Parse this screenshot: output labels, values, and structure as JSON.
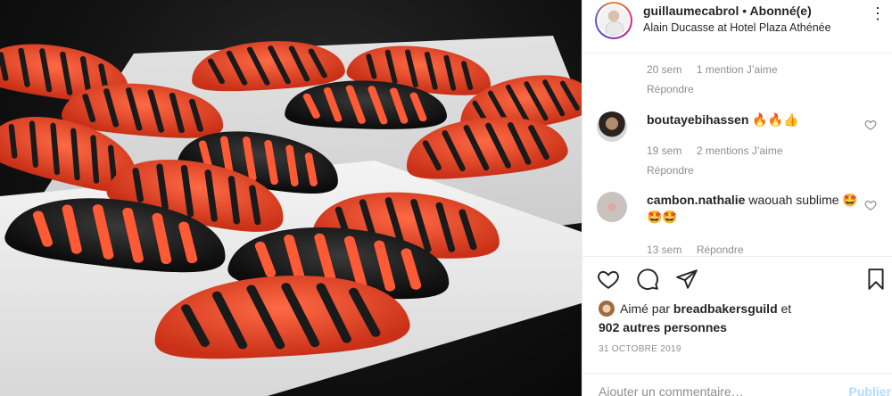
{
  "post": {
    "username": "guillaumecabrol",
    "separator": "•",
    "follow_state": "Abonné(e)",
    "location": "Alain Ducasse at Hotel Plaza Athénée",
    "more_icon": "⋮",
    "photo_alt": "Red and black striped pastries arranged on white plates"
  },
  "comments": [
    {
      "time": "20 sem",
      "likes": "1 mention J’aime",
      "reply": "Répondre"
    },
    {
      "user": "boutayebihassen",
      "text": "🔥🔥👍",
      "time": "19 sem",
      "likes": "2 mentions J’aime",
      "reply": "Répondre"
    },
    {
      "user": "cambon.nathalie",
      "text": "waouah sublime 🤩🤩🤩",
      "time": "13 sem",
      "reply": "Répondre"
    }
  ],
  "likes": {
    "prefix": "Aimé par",
    "user": "breadbakersguild",
    "conj": "et",
    "others": "902 autres personnes"
  },
  "date": "31 OCTOBRE 2019",
  "add_comment": {
    "placeholder": "Ajouter un commentaire…",
    "post_label": "Publier"
  },
  "colors": {
    "text": "#262626",
    "muted": "#8e8e8e",
    "border": "#efefef",
    "post_disabled": "#b3dbff",
    "pastry_red": "#e8472a",
    "pastry_black": "#151515"
  }
}
